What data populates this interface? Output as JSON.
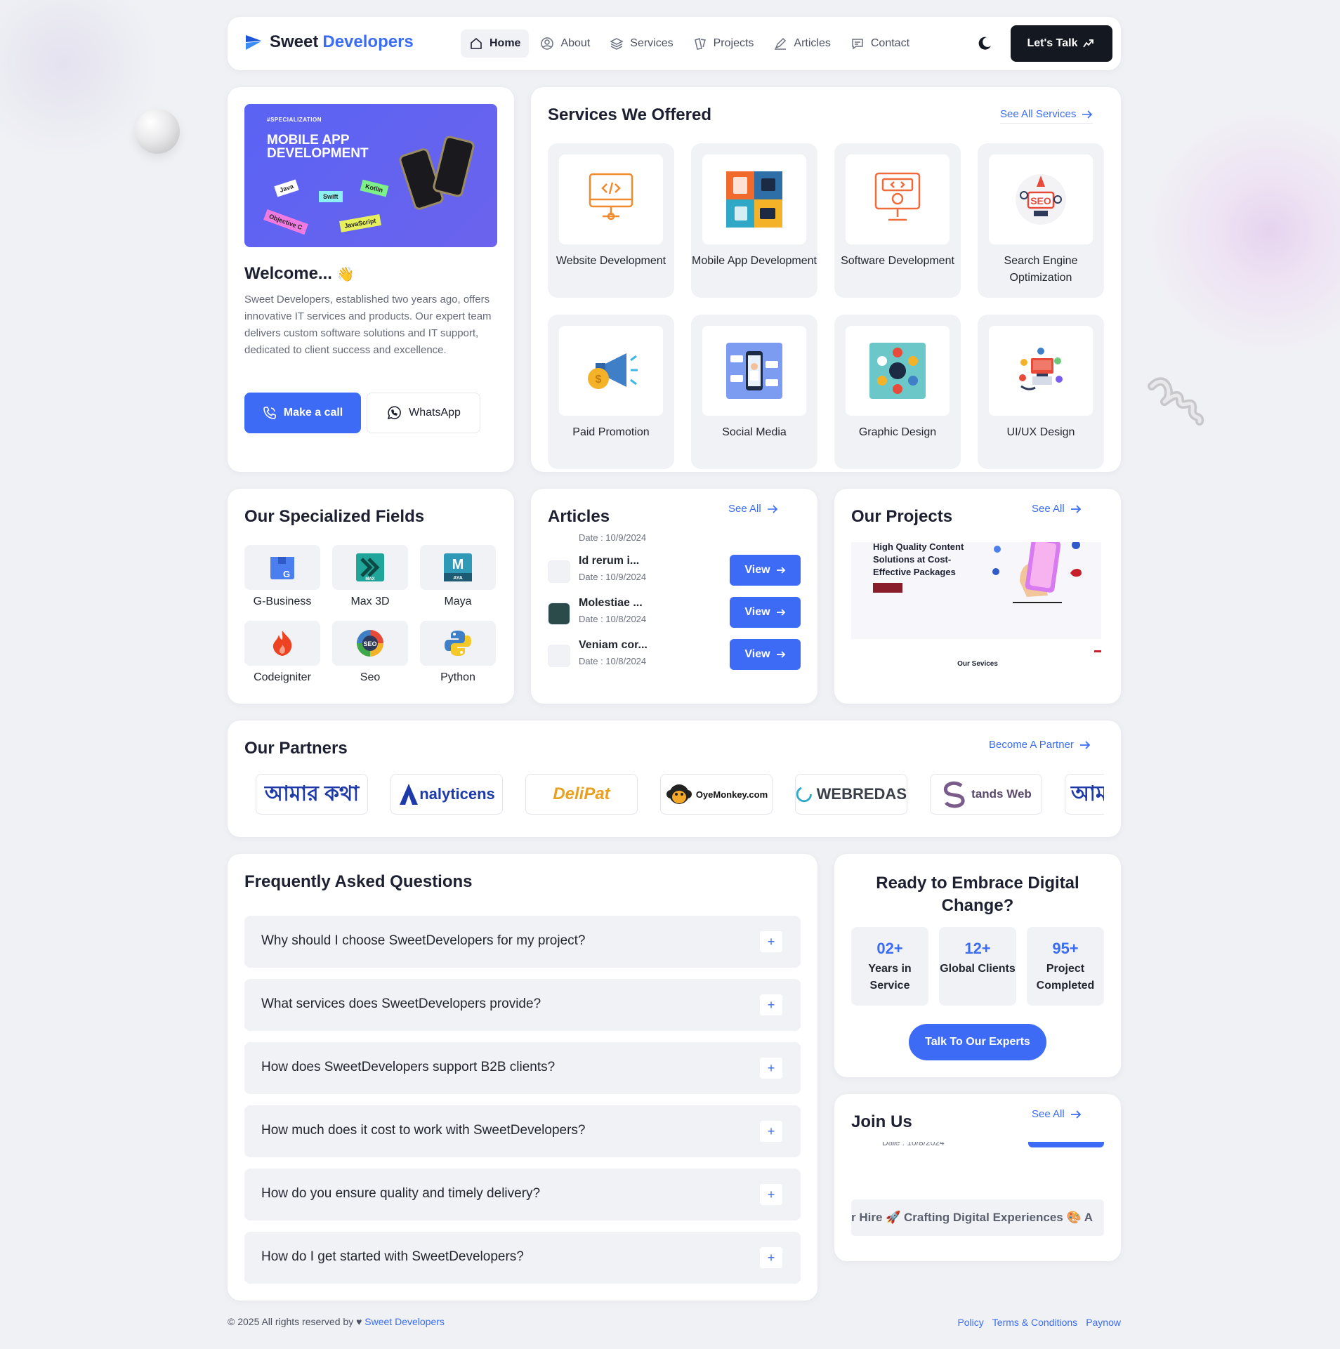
{
  "nav": {
    "brand_first": "Sweet",
    "brand_second": "Developers",
    "items": [
      {
        "label": "Home",
        "icon": "home-icon"
      },
      {
        "label": "About",
        "icon": "user-circle-icon"
      },
      {
        "label": "Services",
        "icon": "layers-icon"
      },
      {
        "label": "Projects",
        "icon": "projects-icon"
      },
      {
        "label": "Articles",
        "icon": "pen-icon"
      },
      {
        "label": "Contact",
        "icon": "chat-icon"
      }
    ],
    "cta": "Let's Talk"
  },
  "welcome": {
    "banner_tag": "#SPECIALIZATION",
    "banner_title": "MOBILE APP DEVELOPMENT",
    "banner_chips": [
      "Java",
      "Swift",
      "Kotlin",
      "Objective C",
      "JavaScript"
    ],
    "heading": "Welcome...",
    "emoji": "👋",
    "text": "Sweet Developers, established two years ago, offers innovative IT services and products. Our expert team delivers custom software solutions and IT support, dedicated to client success and excellence.",
    "call_label": "Make a call",
    "whatsapp_label": "WhatsApp"
  },
  "services": {
    "title": "Services We Offered",
    "see_all": "See All Services",
    "items": [
      {
        "label": "Website Development",
        "icon": "website-icon"
      },
      {
        "label": "Mobile App Development",
        "icon": "mobile-app-icon"
      },
      {
        "label": "Software Development",
        "icon": "software-icon"
      },
      {
        "label": "Search Engine Optimization",
        "icon": "seo-icon"
      },
      {
        "label": "Paid Promotion",
        "icon": "megaphone-icon"
      },
      {
        "label": "Social Media",
        "icon": "social-media-icon"
      },
      {
        "label": "Graphic Design",
        "icon": "graphic-design-icon"
      },
      {
        "label": "UI/UX Design",
        "icon": "uiux-icon"
      }
    ]
  },
  "fields": {
    "title": "Our Specialized Fields",
    "items": [
      {
        "label": "G-Business",
        "icon": "g-business-icon"
      },
      {
        "label": "Max 3D",
        "icon": "max3d-icon"
      },
      {
        "label": "Maya",
        "icon": "maya-icon"
      },
      {
        "label": "Codeigniter",
        "icon": "codeigniter-icon"
      },
      {
        "label": "Seo",
        "icon": "seo-badge-icon"
      },
      {
        "label": "Python",
        "icon": "python-icon"
      }
    ]
  },
  "articles": {
    "title": "Articles",
    "see_all": "See All",
    "view_label": "View",
    "partial_date": "Date : 10/9/2024",
    "items": [
      {
        "title": "Id rerum i...",
        "date": "Date : 10/9/2024"
      },
      {
        "title": "Molestiae ...",
        "date": "Date : 10/8/2024"
      },
      {
        "title": "Veniam cor...",
        "date": "Date : 10/8/2024"
      }
    ]
  },
  "projects": {
    "title": "Our Projects",
    "see_all": "See All",
    "preview_text": "High Quality Content Solutions at Cost-Effective Packages",
    "preview_caption": "Our Sevices"
  },
  "partners": {
    "title": "Our Partners",
    "cta": "Become A Partner",
    "logos": [
      "আমার কথা",
      "nalyticens",
      "DeliPat",
      "OyeMonkey.com",
      "WEBREDAS",
      "tands Web",
      "আম"
    ]
  },
  "faq": {
    "title": "Frequently Asked Questions",
    "items": [
      "Why should I choose SweetDevelopers for my project?",
      "What services does SweetDevelopers provide?",
      "How does SweetDevelopers support B2B clients?",
      "How much does it cost to work with SweetDevelopers?",
      "How do you ensure quality and timely delivery?",
      "How do I get started with SweetDevelopers?"
    ]
  },
  "ready": {
    "title": "Ready to Embrace Digital Change?",
    "stats": [
      {
        "value": "02+",
        "label": "Years in Service"
      },
      {
        "value": "12+",
        "label": "Global Clients"
      },
      {
        "value": "95+",
        "label": "Project Completed"
      }
    ],
    "cta": "Talk To Our Experts"
  },
  "join": {
    "title": "Join Us",
    "see_all": "See All",
    "partial_date": "Date : 10/8/2024",
    "marquee": "r Hire 🚀 Crafting Digital Experiences 🎨 A"
  },
  "footer": {
    "copyright": "© 2025 All rights reserved by ♥",
    "brand": "Sweet Developers",
    "links": [
      "Policy",
      "Terms & Conditions",
      "Paynow"
    ]
  },
  "colors": {
    "accent": "#3e6bf5",
    "dark": "#141821",
    "background": "#f0f1f5"
  }
}
